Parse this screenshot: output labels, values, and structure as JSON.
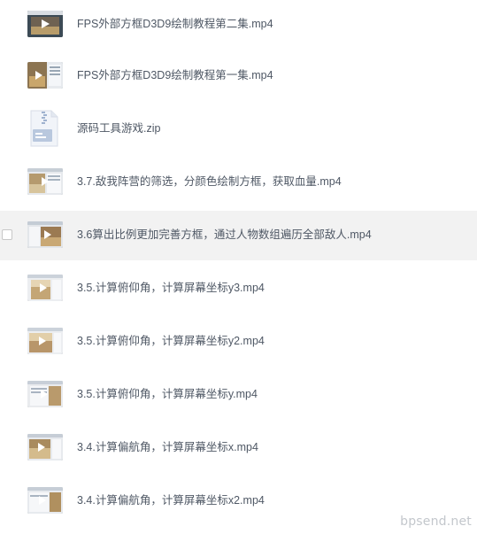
{
  "files": [
    {
      "name": "FPS外部方框D3D9绘制教程第二集.mp4",
      "type": "video"
    },
    {
      "name": "FPS外部方框D3D9绘制教程第一集.mp4",
      "type": "video"
    },
    {
      "name": "源码工具游戏.zip",
      "type": "zip"
    },
    {
      "name": "3.7.敌我阵营的筛选，分颜色绘制方框，获取血量.mp4",
      "type": "video"
    },
    {
      "name": "3.6算出比例更加完善方框，通过人物数组遍历全部敌人.mp4",
      "type": "video",
      "selected": true
    },
    {
      "name": "3.5.计算俯仰角，计算屏幕坐标y3.mp4",
      "type": "video"
    },
    {
      "name": "3.5.计算俯仰角，计算屏幕坐标y2.mp4",
      "type": "video"
    },
    {
      "name": "3.5.计算俯仰角，计算屏幕坐标y.mp4",
      "type": "video"
    },
    {
      "name": "3.4.计算偏航角，计算屏幕坐标x.mp4",
      "type": "video"
    },
    {
      "name": "3.4.计算偏航角，计算屏幕坐标x2.mp4",
      "type": "video"
    }
  ],
  "watermark": "bpsend.net"
}
